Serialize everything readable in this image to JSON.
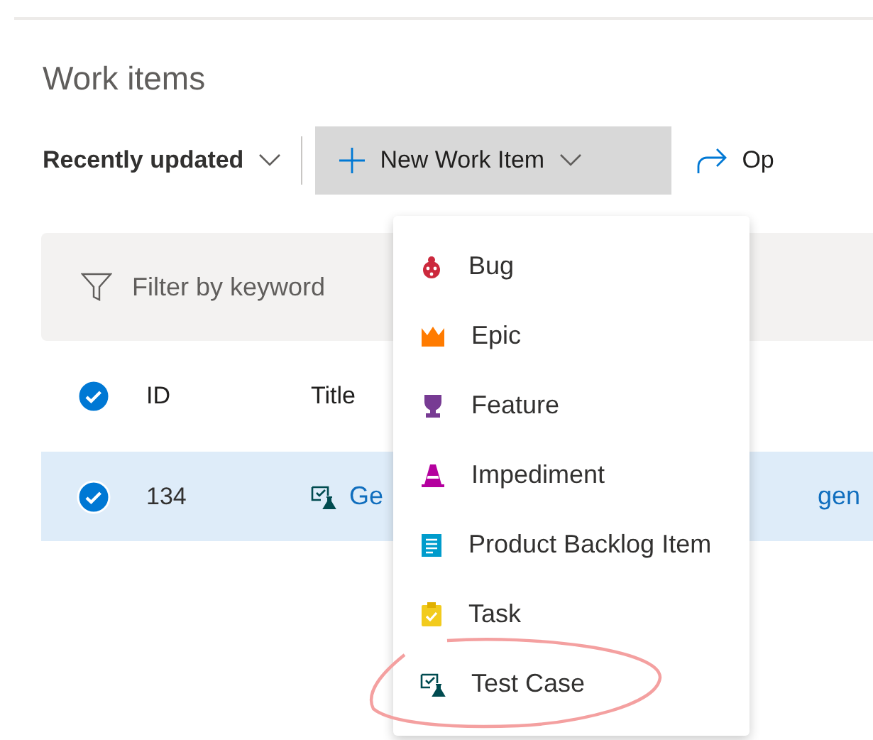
{
  "page": {
    "title": "Work items"
  },
  "toolbar": {
    "view": {
      "label": "Recently updated"
    },
    "new_button": {
      "label": "New Work Item",
      "expanded": true
    },
    "open_button": {
      "label": "Op"
    }
  },
  "filter": {
    "placeholder": "Filter by keyword"
  },
  "table": {
    "header": {
      "checked": true,
      "columns": [
        "ID",
        "Title"
      ]
    },
    "rows": [
      {
        "selected": true,
        "checked": true,
        "id": "134",
        "title_parts": [
          "Ge",
          "gen"
        ]
      }
    ]
  },
  "menu": {
    "items": [
      {
        "kind": "bug",
        "label": "Bug",
        "circled": false
      },
      {
        "kind": "epic",
        "label": "Epic",
        "circled": false
      },
      {
        "kind": "feature",
        "label": "Feature",
        "circled": false
      },
      {
        "kind": "impediment",
        "label": "Impediment",
        "circled": false
      },
      {
        "kind": "pbi",
        "label": "Product Backlog Item",
        "circled": false
      },
      {
        "kind": "task",
        "label": "Task",
        "circled": false
      },
      {
        "kind": "testcase",
        "label": "Test Case",
        "circled": true
      }
    ]
  }
}
